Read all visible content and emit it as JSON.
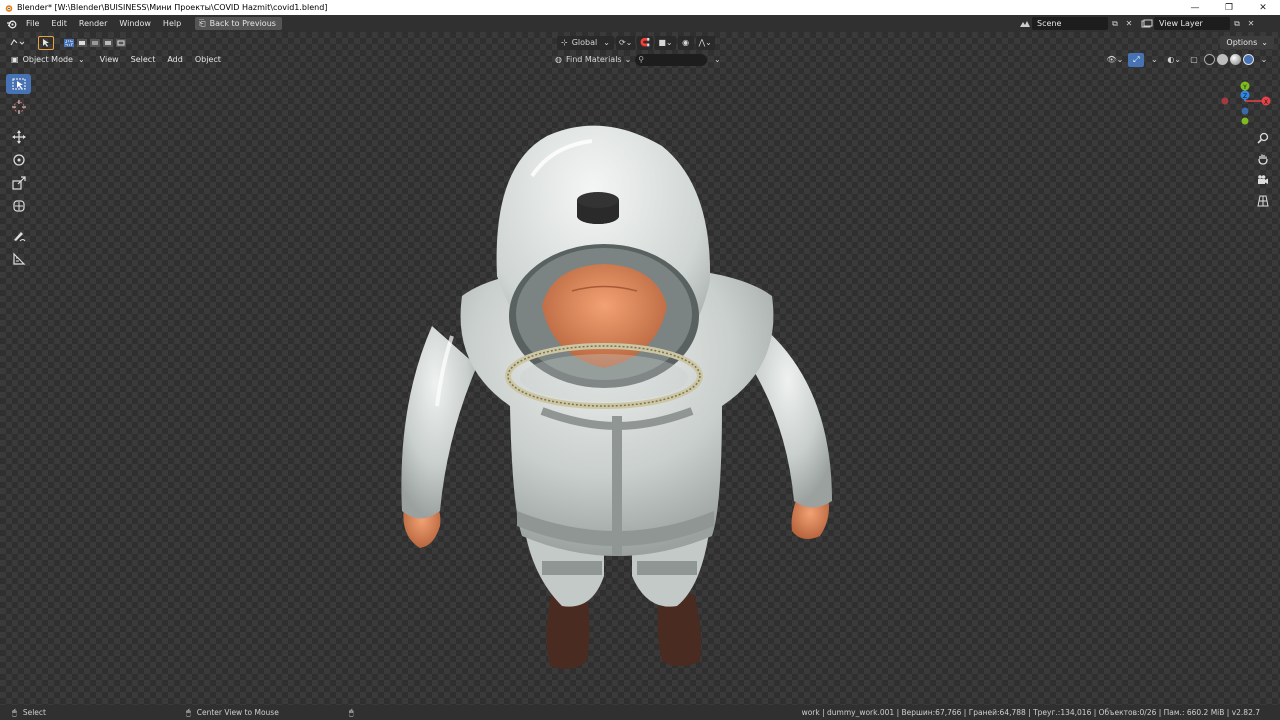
{
  "window": {
    "title": "Blender* [W:\\Blender\\BUISINESS\\Мини Проекты\\COVID Hazmit\\covid1.blend]",
    "minimize": "—",
    "maximize": "❐",
    "close": "✕"
  },
  "menubar": {
    "items": [
      "File",
      "Edit",
      "Render",
      "Window",
      "Help"
    ],
    "back_button": "Back to Previous",
    "scene": "Scene",
    "view_layer": "View Layer"
  },
  "viewport_header": {
    "transform_orientation": "Global",
    "options": "Options",
    "mode": "Object Mode",
    "menus": [
      "View",
      "Select",
      "Add",
      "Object"
    ],
    "find_materials": "Find Materials",
    "search_placeholder": ""
  },
  "statusbar": {
    "select": "Select",
    "center_view": "Center View to Mouse",
    "stats": "work | dummy_work.001 | Вершин:67,766 | Граней:64,788 | Треуг.:134,016 | Объектов:0/26 | Пам.: 660.2 MiB | v2.82.7"
  },
  "gizmo": {
    "x_label": "X",
    "y_label": "Y",
    "z_label": "Z"
  },
  "colors": {
    "active_blue": "#4772b3",
    "axis_x": "#e8424a",
    "axis_y": "#7fbd1f",
    "axis_z": "#2f86e8"
  }
}
